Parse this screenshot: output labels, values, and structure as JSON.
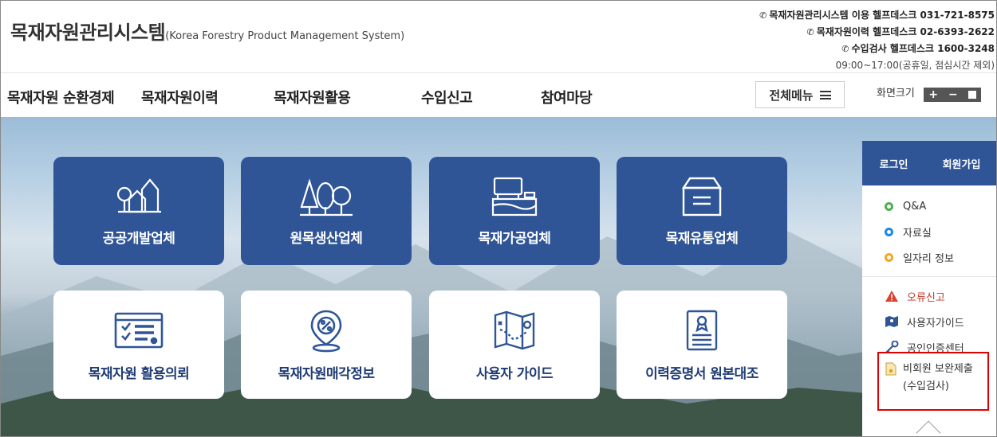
{
  "header": {
    "title": "목재자원관리시스템",
    "subtitle": "(Korea Forestry Product Management System)",
    "helpdesk": [
      "목재자원관리시스템 이용 헬프데스크 031-721-8575",
      "목재자원이력 헬프데스크 02-6393-2622",
      "수입검사 헬프데스크 1600-3248"
    ],
    "hours": "09:00~17:00(공휴일, 점심시간 제외)",
    "phone_icon": "phone-icon"
  },
  "nav": {
    "items": [
      "목재자원 순환경제",
      "목재자원이력",
      "목재자원활용",
      "수입신고",
      "참여마당"
    ],
    "all_menu": "전체메뉴",
    "zoom_label": "화면크기",
    "zoom_plus": "+",
    "zoom_minus": "−"
  },
  "tiles_top": [
    {
      "label": "공공개발업체",
      "icon": "houses-trees-icon"
    },
    {
      "label": "원목생산업체",
      "icon": "trees-icon"
    },
    {
      "label": "목재가공업체",
      "icon": "lumber-cutting-icon"
    },
    {
      "label": "목재유통업체",
      "icon": "box-icon"
    }
  ],
  "tiles_bottom": [
    {
      "label": "목재자원 활용의뢰",
      "icon": "certificate-icon"
    },
    {
      "label": "목재자원매각정보",
      "icon": "percent-location-icon"
    },
    {
      "label": "사용자 가이드",
      "icon": "map-icon"
    },
    {
      "label": "이력증명서 원본대조",
      "icon": "document-award-icon"
    }
  ],
  "side": {
    "login": "로그인",
    "signup": "회원가입",
    "links": [
      {
        "label": "Q&A",
        "color": "#4caf50"
      },
      {
        "label": "자료실",
        "color": "#1e88e5"
      },
      {
        "label": "일자리 정보",
        "color": "#f5a623"
      }
    ],
    "tools": [
      {
        "label": "오류신고",
        "icon": "warning-icon"
      },
      {
        "label": "사용자가이드",
        "icon": "guide-map-icon"
      },
      {
        "label": "공인인증센터",
        "icon": "key-icon"
      }
    ],
    "guest_submit_line1": "비회원 보완제출",
    "guest_submit_line2": "(수입검사)"
  },
  "colors": {
    "tile_blue": "#2f5597",
    "tile_text_dark": "#1f3b73",
    "error_red": "#c0392b",
    "highlight_red": "#e00000"
  }
}
